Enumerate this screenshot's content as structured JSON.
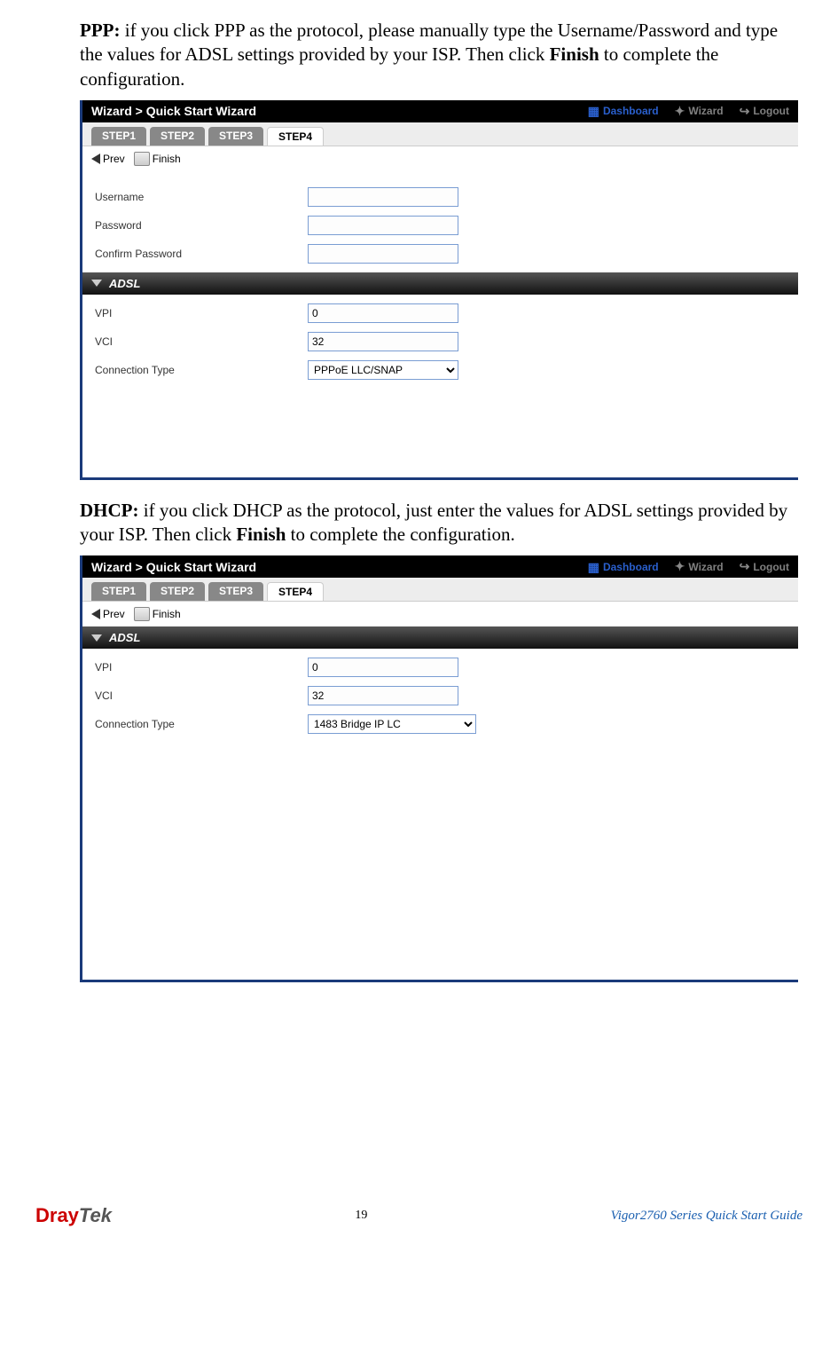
{
  "para1": {
    "b1": "PPP:",
    "t1": " if you click PPP as the protocol, please manually type the Username/Password and type the values for ADSL settings provided by your ISP. Then click ",
    "b2": "Finish",
    "t2": " to complete the configuration."
  },
  "para2": {
    "b1": "DHCP:",
    "t1": " if you click DHCP as the protocol, just enter the values for ADSL settings provided by your ISP. Then click ",
    "b2": "Finish",
    "t2": " to complete the configuration."
  },
  "wizardTitle": "Wizard > Quick Start Wizard",
  "headerLinks": {
    "dash": "Dashboard",
    "wiz": "Wizard",
    "out": "Logout"
  },
  "tabs": {
    "s1": "STEP1",
    "s2": "STEP2",
    "s3": "STEP3",
    "s4": "STEP4"
  },
  "toolbar": {
    "prev": "Prev",
    "finish": "Finish"
  },
  "form": {
    "username": "Username",
    "password": "Password",
    "confirm": "Confirm Password",
    "adsl": "ADSL",
    "vpi": "VPI",
    "vci": "VCI",
    "ctype": "Connection Type",
    "vpiVal": "0",
    "vciVal": "32",
    "ctypeVal1": "PPPoE LLC/SNAP",
    "ctypeVal2": "1483 Bridge IP LC"
  },
  "footer": {
    "logo1": "Dray",
    "logo2": "Tek",
    "pagenum": "19",
    "guide": "Vigor2760 Series Quick Start Guide"
  }
}
